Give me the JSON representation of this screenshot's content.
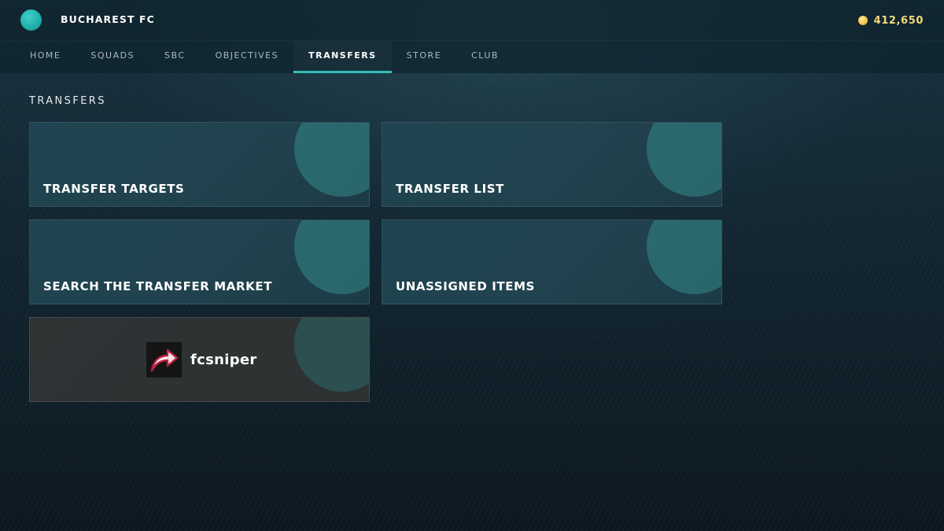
{
  "header": {
    "club_name": "BUCHAREST FC",
    "coins": "412,650",
    "badge_color": "#2ab8b2",
    "coin_color": "#f3c74c"
  },
  "nav": {
    "active_color": "#35bdb7",
    "tabs": [
      {
        "label": "HOME",
        "active": false
      },
      {
        "label": "SQUADS",
        "active": false
      },
      {
        "label": "SBC",
        "active": false
      },
      {
        "label": "OBJECTIVES",
        "active": false
      },
      {
        "label": "TRANSFERS",
        "active": true
      },
      {
        "label": "STORE",
        "active": false
      },
      {
        "label": "CLUB",
        "active": false
      }
    ]
  },
  "main": {
    "section_title": "TRANSFERS",
    "tiles": [
      {
        "label": "TRANSFER TARGETS"
      },
      {
        "label": "TRANSFER LIST"
      },
      {
        "label": "SEARCH THE TRANSFER MARKET"
      },
      {
        "label": "UNASSIGNED ITEMS"
      }
    ],
    "plugin_tile": {
      "name": "fcsniper",
      "icon": "share-arrow-icon"
    }
  }
}
